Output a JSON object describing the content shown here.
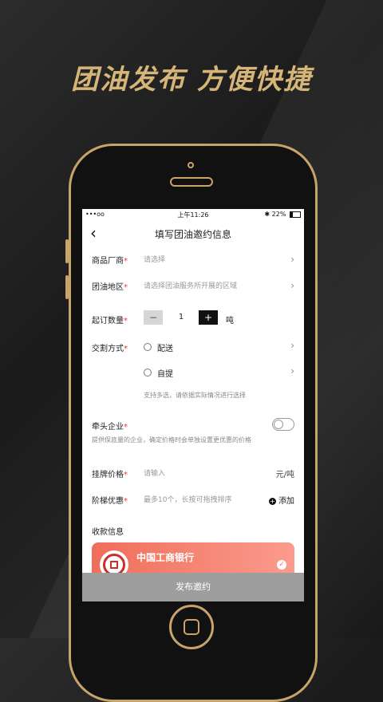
{
  "headline": "团油发布  方便快捷",
  "status": {
    "signal": "•••oo",
    "time": "上午11:26",
    "bluetooth": "✱",
    "battery": "22%"
  },
  "nav": {
    "back": "‹",
    "title": "填写团油邀约信息"
  },
  "fields": {
    "vendor": {
      "label": "商品厂商",
      "req": "*",
      "placeholder": "请选择"
    },
    "region": {
      "label": "团油地区",
      "req": "*",
      "placeholder": "请选择团油服务所开展的区域"
    },
    "min_qty": {
      "label": "起订数量",
      "req": "*",
      "minus": "−",
      "value": "1",
      "plus": "+",
      "unit": "吨"
    },
    "delivery": {
      "label": "交割方式",
      "req": "*",
      "option1": "配送",
      "option2": "自提",
      "hint": "支持多选，请依据实际情况进行选择"
    },
    "lead": {
      "label": "牵头企业",
      "req": "*",
      "hint": "提供保底量的企业，确定价格时会单独设置更优惠的价格"
    },
    "price": {
      "label": "挂牌价格",
      "req": "*",
      "placeholder": "请输入",
      "unit": "元/吨"
    },
    "tier": {
      "label": "阶梯优惠",
      "req": "*",
      "placeholder": "最多10个，长按可拖拽排序",
      "add": "添加"
    }
  },
  "payment": {
    "title": "收款信息",
    "bank": "中国工商银行"
  },
  "submit": "发布邀约",
  "colors": {
    "gold": "#c7a467",
    "bank_card": "#ef6e5a",
    "required": "#e53935"
  }
}
